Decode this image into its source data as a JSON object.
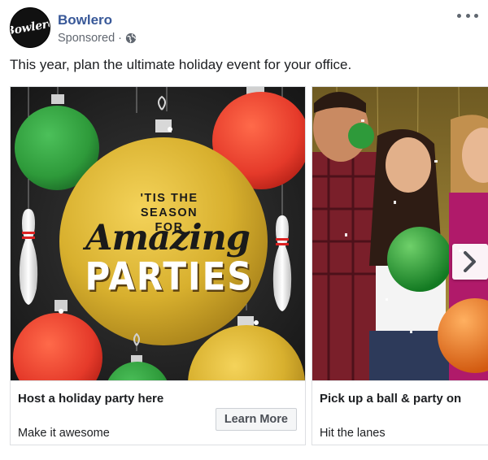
{
  "post": {
    "page_name": "Bowlero",
    "avatar_text": "Bowlero",
    "sponsored_label": "Sponsored",
    "separator": "·",
    "message": "This year, plan the ultimate holiday event for your office."
  },
  "cards": [
    {
      "image_text": {
        "line1a": "'TIS THE",
        "line1b": "SEASON FOR",
        "line2": "Amazing",
        "line3": "PARTIES"
      },
      "title": "Host a holiday party here",
      "description": "Make it awesome",
      "cta": "Learn More"
    },
    {
      "title": "Pick up a ball & party on",
      "description": "Hit the lanes"
    }
  ],
  "icons": {
    "globe": "globe-icon",
    "more": "more-options-icon",
    "next": "chevron-right-icon"
  },
  "colors": {
    "page_name": "#385898",
    "meta": "#616770",
    "gold_ornament": "#d8b02e",
    "red_ornament": "#e53a2a",
    "green_ornament": "#2e9a3a"
  }
}
